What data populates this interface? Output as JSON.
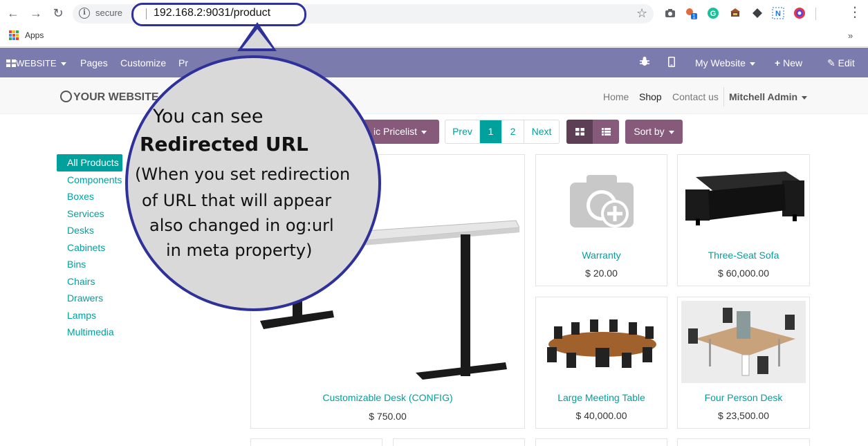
{
  "browser": {
    "security_label": "secure",
    "url": "192.168.2:9031/product",
    "bookmarks_apps": "Apps",
    "overflow": "»"
  },
  "admin_bar": {
    "website_label": "WEBSITE",
    "pages_label": "Pages",
    "customize_label": "Customize",
    "promote_partial": "Pr",
    "my_website_label": "My Website",
    "new_label": "New",
    "edit_label": "Edit"
  },
  "site": {
    "logo_text": "YOUR WEBSITE",
    "nav": [
      "Home",
      "Shop",
      "Contact us"
    ],
    "user": "Mitchell Admin"
  },
  "toolbar": {
    "pricelist_label": "ic Pricelist",
    "pager": [
      "Prev",
      "1",
      "2",
      "Next"
    ],
    "sort_label": "Sort by"
  },
  "categories": [
    "All Products",
    "Components",
    "Boxes",
    "Services",
    "Desks",
    "Cabinets",
    "Bins",
    "Chairs",
    "Drawers",
    "Lamps",
    "Multimedia"
  ],
  "products": [
    {
      "name": "Customizable Desk (CONFIG)",
      "price": "$ 750.00"
    },
    {
      "name": "Warranty",
      "price": "$ 20.00"
    },
    {
      "name": "Three-Seat Sofa",
      "price": "$ 60,000.00"
    },
    {
      "name": "Large Meeting Table",
      "price": "$ 40,000.00"
    },
    {
      "name": "Four Person Desk",
      "price": "$ 23,500.00"
    }
  ],
  "callout": {
    "line1": "You can see",
    "line2": "Redirected URL",
    "line3": "(When you set redirection",
    "line4": "of URL that will appear",
    "line5": "also changed in og:url",
    "line6": "in meta property)"
  },
  "colors": {
    "admin_bar": "#7c7bad",
    "odoo_purple": "#875a7b",
    "teal": "#00a09d",
    "callout_border": "#2f319a",
    "callout_fill": "#d9d9d9"
  }
}
